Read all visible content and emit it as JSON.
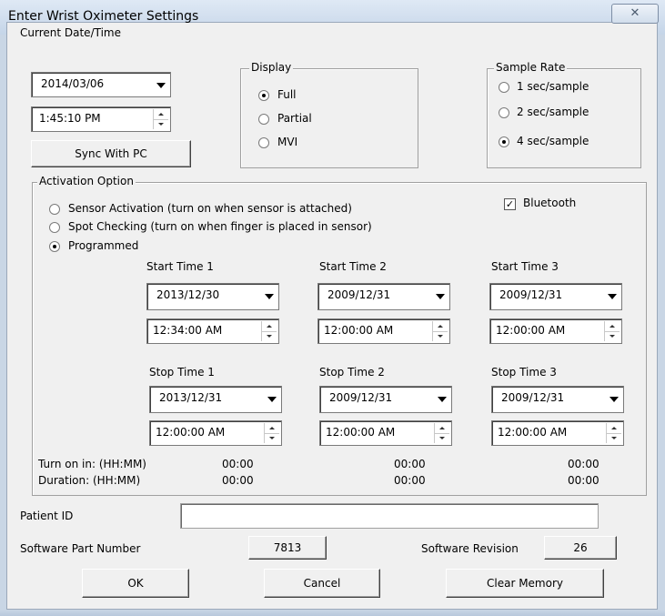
{
  "window": {
    "title": "Enter Wrist Oximeter Settings",
    "close_glyph": "✕"
  },
  "current_datetime": {
    "label": "Current Date/Time",
    "date": "2014/03/06",
    "time": "1:45:10 PM",
    "sync_label": "Sync With PC"
  },
  "display": {
    "legend": "Display",
    "options": [
      {
        "label": "Full",
        "selected": true
      },
      {
        "label": "Partial",
        "selected": false
      },
      {
        "label": "MVI",
        "selected": false
      }
    ]
  },
  "sample_rate": {
    "legend": "Sample Rate",
    "options": [
      {
        "label": "1 sec/sample",
        "selected": false
      },
      {
        "label": "2 sec/sample",
        "selected": false
      },
      {
        "label": "4 sec/sample",
        "selected": true
      }
    ]
  },
  "activation": {
    "legend": "Activation Option",
    "options": [
      {
        "label": "Sensor Activation (turn on when sensor is attached)",
        "selected": false
      },
      {
        "label": "Spot Checking (turn on when finger is placed in sensor)",
        "selected": false
      },
      {
        "label": "Programmed",
        "selected": true
      }
    ],
    "bluetooth": {
      "label": "Bluetooth",
      "checked": true,
      "glyph": "✓"
    },
    "slots": [
      {
        "start_label": "Start Time 1",
        "start_date": "2013/12/30",
        "start_time": "12:34:00 AM",
        "stop_label": "Stop Time 1",
        "stop_date": "2013/12/31",
        "stop_time": "12:00:00 AM",
        "turn_on": "00:00",
        "duration": "00:00"
      },
      {
        "start_label": "Start Time 2",
        "start_date": "2009/12/31",
        "start_time": "12:00:00 AM",
        "stop_label": "Stop Time 2",
        "stop_date": "2009/12/31",
        "stop_time": "12:00:00 AM",
        "turn_on": "00:00",
        "duration": "00:00"
      },
      {
        "start_label": "Start Time 3",
        "start_date": "2009/12/31",
        "start_time": "12:00:00 AM",
        "stop_label": "Stop Time 3",
        "stop_date": "2009/12/31",
        "stop_time": "12:00:00 AM",
        "turn_on": "00:00",
        "duration": "00:00"
      }
    ],
    "turn_on_label": "Turn on in: (HH:MM)",
    "duration_label": "Duration:  (HH:MM)"
  },
  "patient": {
    "label": "Patient ID",
    "value": ""
  },
  "software": {
    "part_label": "Software Part Number",
    "part_value": "7813",
    "revision_label": "Software Revision",
    "revision_value": "26"
  },
  "buttons": {
    "ok": "OK",
    "cancel": "Cancel",
    "clear": "Clear Memory"
  }
}
